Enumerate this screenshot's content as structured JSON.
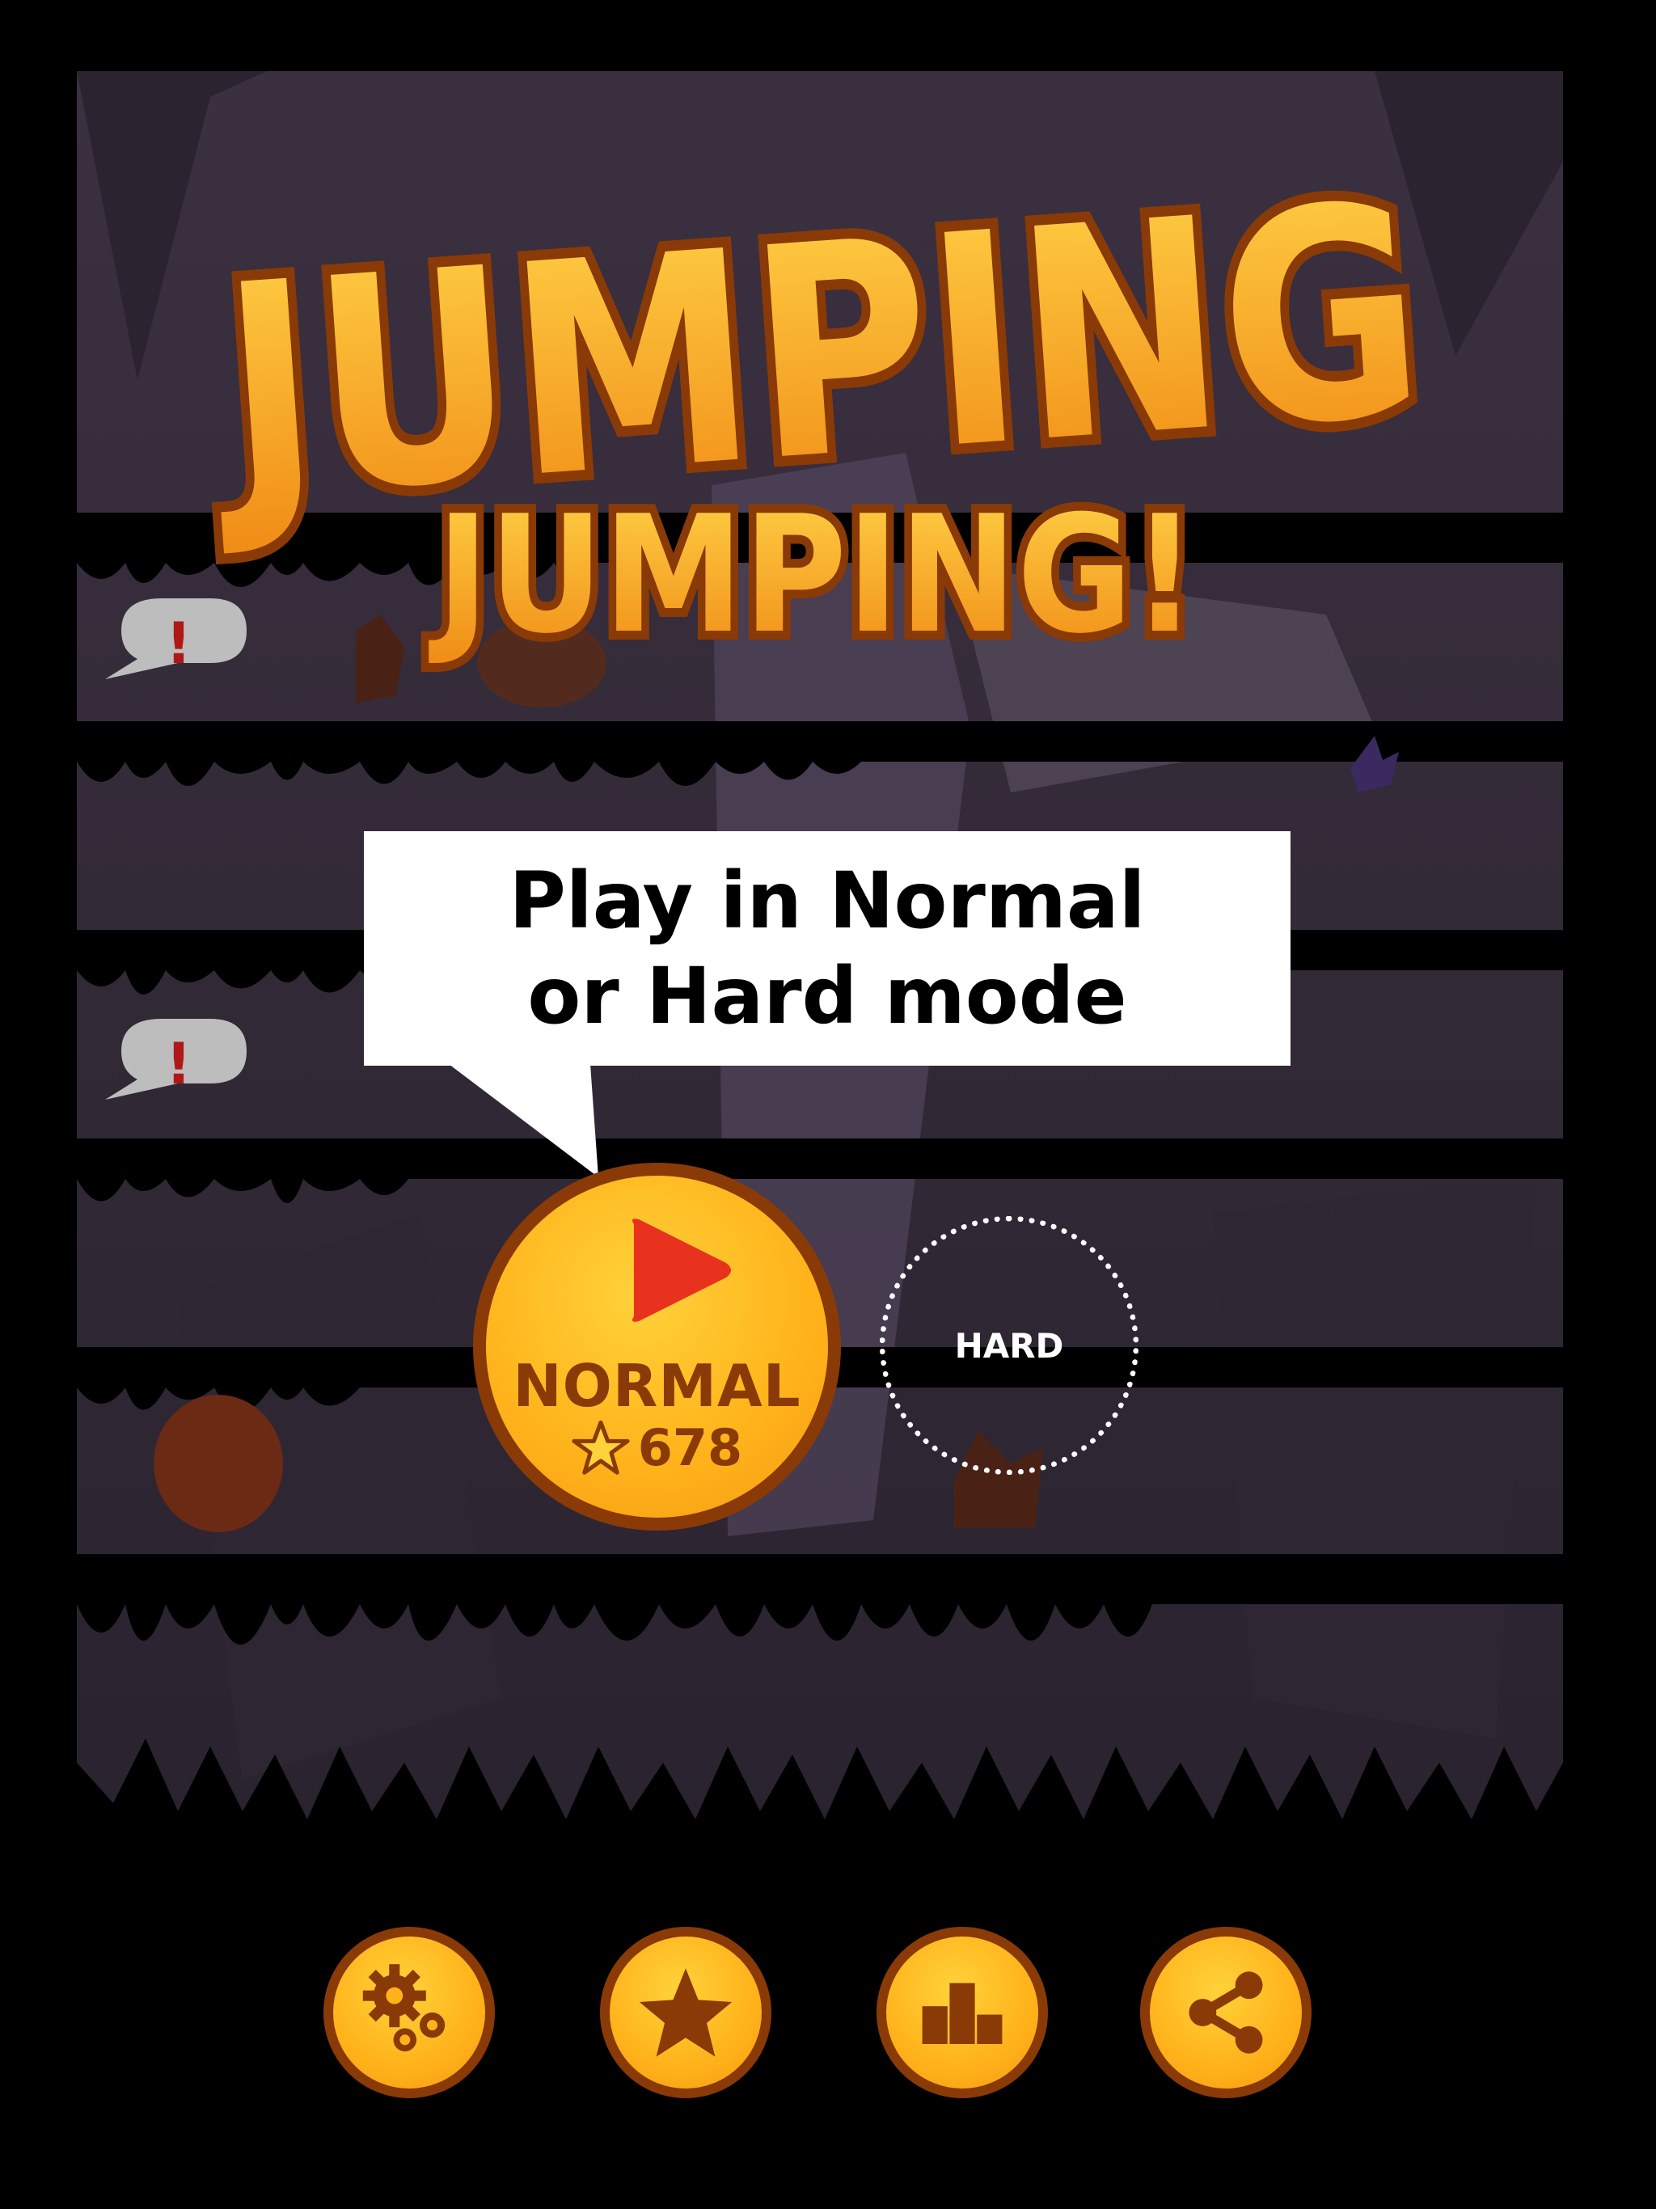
{
  "game": {
    "title_line1": "JUMPING",
    "title_line2": "JUMPING!"
  },
  "tooltip": {
    "line1": "Play in Normal",
    "line2": "or Hard mode"
  },
  "modes": {
    "normal": {
      "label": "NORMAL",
      "best_score": "678",
      "icon": "play-icon"
    },
    "hard": {
      "label": "HARD"
    }
  },
  "toolbar": [
    {
      "id": "settings",
      "icon": "gears-icon"
    },
    {
      "id": "rate",
      "icon": "star-icon"
    },
    {
      "id": "leaderboard",
      "icon": "leaderboard-icon"
    },
    {
      "id": "share",
      "icon": "share-icon"
    }
  ],
  "colors": {
    "accent_yellow": "#ffb21a",
    "accent_brown": "#8a3a06",
    "play_red": "#e8321e",
    "background": "#000000"
  }
}
